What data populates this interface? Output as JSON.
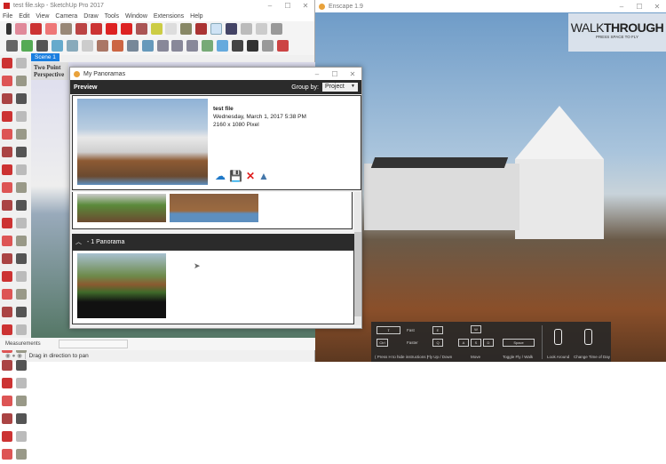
{
  "sketchup": {
    "title": "test file.skp - SketchUp Pro 2017",
    "menu": [
      "File",
      "Edit",
      "View",
      "Camera",
      "Draw",
      "Tools",
      "Window",
      "Extensions",
      "Help"
    ],
    "scene_tab": "Scene 1",
    "view_label_1": "Two Point",
    "view_label_2": "Perspective",
    "measurements_label": "Measurements",
    "measurements_value": "",
    "status": "Drag in direction to pan"
  },
  "enscape": {
    "title": "Enscape 1.9",
    "walk_light": "WALK",
    "walk_bold": "THROUGH",
    "walk_sub": "PRESS SPACE TO FLY",
    "controls": {
      "fast": "Fast",
      "faster": "Faster",
      "shift_key": "⇧",
      "ctrl_key": "Ctrl",
      "hint": "( Press H to hide instructions )",
      "e_key": "E",
      "q_key": "Q",
      "fly": "Fly Up / Down",
      "w_key": "W",
      "a_key": "A",
      "s_key": "S",
      "d_key": "D",
      "move": "Move",
      "space_key": "Space",
      "toggle": "Toggle Fly / Walk",
      "look": "Look Around",
      "time": "Change Time of Day"
    }
  },
  "panoramas": {
    "title": "My Panoramas",
    "preview_label": "Preview",
    "group_by_label": "Group by:",
    "group_by_value": "Project",
    "file_name": "test file",
    "date": "Wednesday, March 1, 2017 5:38 PM",
    "resolution": "2160 x 1080 Pixel",
    "group_header": "- 1 Panorama"
  },
  "colors": {
    "accent": "#0078d7",
    "dark_header": "#2b2b2b"
  }
}
